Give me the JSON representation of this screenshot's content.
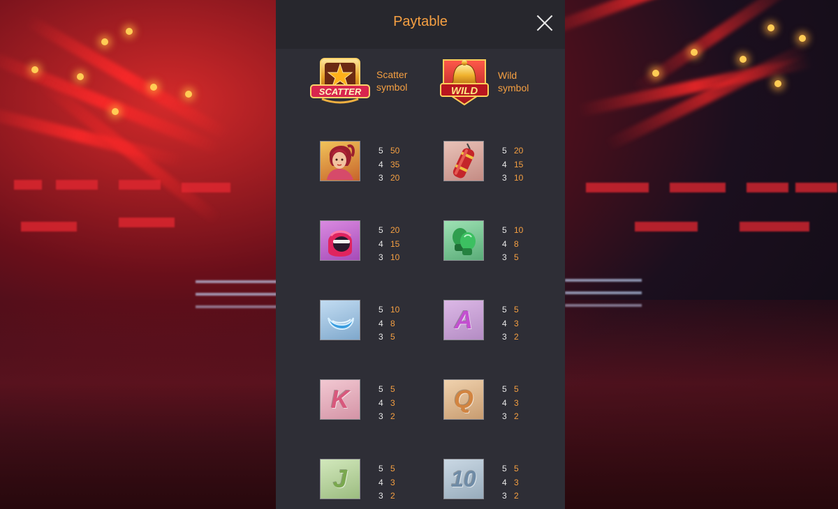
{
  "panel": {
    "title": "Paytable",
    "close_icon": "close-icon"
  },
  "specials": [
    {
      "name": "scatter",
      "badge": "SCATTER",
      "label_line1": "Scatter",
      "label_line2": "symbol",
      "icon": "scatter-star-icon"
    },
    {
      "name": "wild",
      "badge": "WILD",
      "label_line1": "Wild",
      "label_line2": "symbol",
      "icon": "wild-bell-icon"
    }
  ],
  "symbols": [
    {
      "id": "boxer",
      "icon": "boxer-woman-icon",
      "pays": [
        {
          "count": "5",
          "value": "50"
        },
        {
          "count": "4",
          "value": "35"
        },
        {
          "count": "3",
          "value": "20"
        }
      ],
      "bg": "#e8a23a"
    },
    {
      "id": "punching-bag",
      "icon": "punching-bag-icon",
      "pays": [
        {
          "count": "5",
          "value": "20"
        },
        {
          "count": "4",
          "value": "15"
        },
        {
          "count": "3",
          "value": "10"
        }
      ],
      "bg": "#d8a89a"
    },
    {
      "id": "helmet",
      "icon": "boxing-helmet-icon",
      "pays": [
        {
          "count": "5",
          "value": "20"
        },
        {
          "count": "4",
          "value": "15"
        },
        {
          "count": "3",
          "value": "10"
        }
      ],
      "bg": "#c46ad0"
    },
    {
      "id": "gloves",
      "icon": "boxing-gloves-icon",
      "pays": [
        {
          "count": "5",
          "value": "10"
        },
        {
          "count": "4",
          "value": "8"
        },
        {
          "count": "3",
          "value": "5"
        }
      ],
      "bg": "#7fcf9a"
    },
    {
      "id": "mouthguard",
      "icon": "mouthguard-icon",
      "pays": [
        {
          "count": "5",
          "value": "10"
        },
        {
          "count": "4",
          "value": "8"
        },
        {
          "count": "3",
          "value": "5"
        }
      ],
      "bg": "#9ec6ea"
    },
    {
      "id": "A",
      "icon": "letter-a-icon",
      "letter": "A",
      "pays": [
        {
          "count": "5",
          "value": "5"
        },
        {
          "count": "4",
          "value": "3"
        },
        {
          "count": "3",
          "value": "2"
        }
      ],
      "bg": "#c9a0d6",
      "fg": "#c34fd0"
    },
    {
      "id": "K",
      "icon": "letter-k-icon",
      "letter": "K",
      "pays": [
        {
          "count": "5",
          "value": "5"
        },
        {
          "count": "4",
          "value": "3"
        },
        {
          "count": "3",
          "value": "2"
        }
      ],
      "bg": "#e8b4c2",
      "fg": "#d8587c"
    },
    {
      "id": "Q",
      "icon": "letter-q-icon",
      "letter": "Q",
      "pays": [
        {
          "count": "5",
          "value": "5"
        },
        {
          "count": "4",
          "value": "3"
        },
        {
          "count": "3",
          "value": "2"
        }
      ],
      "bg": "#e6c29c",
      "fg": "#d28440"
    },
    {
      "id": "J",
      "icon": "letter-j-icon",
      "letter": "J",
      "pays": [
        {
          "count": "5",
          "value": "5"
        },
        {
          "count": "4",
          "value": "3"
        },
        {
          "count": "3",
          "value": "2"
        }
      ],
      "bg": "#bfdaa6",
      "fg": "#7aa84e"
    },
    {
      "id": "10",
      "icon": "letter-10-icon",
      "letter": "10",
      "pays": [
        {
          "count": "5",
          "value": "5"
        },
        {
          "count": "4",
          "value": "3"
        },
        {
          "count": "3",
          "value": "2"
        }
      ],
      "bg": "#b6c8d6",
      "fg": "#6f8ba6"
    }
  ]
}
